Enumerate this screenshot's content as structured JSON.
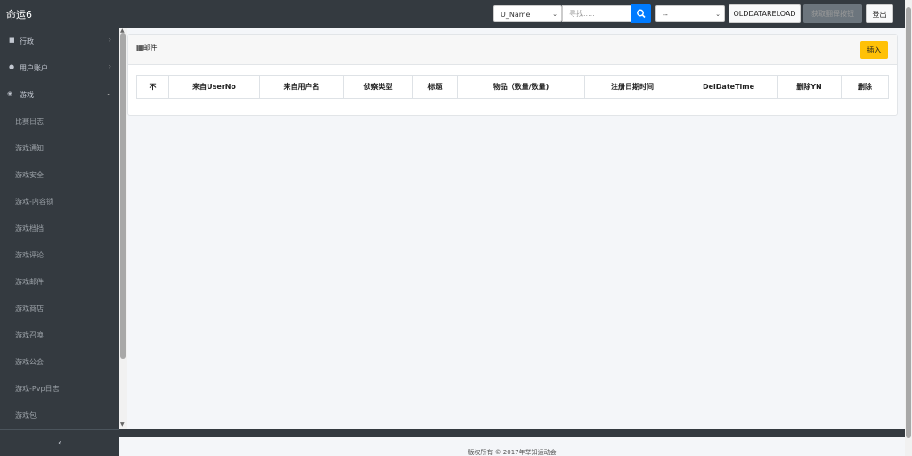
{
  "app": {
    "title": "命运6"
  },
  "header": {
    "field_select": "U_Name",
    "search_placeholder": "寻找.....",
    "second_select": "--",
    "reload_button": "OLDDATARELOAD",
    "disabled_button": "获取翻译按钮",
    "logout_button": "登出"
  },
  "sidebar": {
    "sections": [
      {
        "label": "行政",
        "icon": "bookmark-icon"
      },
      {
        "label": "用户账户",
        "icon": "user-icon"
      },
      {
        "label": "游戏",
        "icon": "gamepad-icon"
      }
    ],
    "subitems": [
      "比赛日志",
      "游戏通知",
      "游戏安全",
      "游戏-内容锁",
      "游戏档挡",
      "游戏评论",
      "游戏邮件",
      "游戏商店",
      "游戏召唤",
      "游戏公会",
      "游戏-Pvp日志",
      "游戏包"
    ],
    "collapse_label": "‹"
  },
  "card": {
    "title": "邮件",
    "insert_button": "插入",
    "columns": [
      "不",
      "来自UserNo",
      "来自用户名",
      "侦察类型",
      "标题",
      "物品（数量/数量)",
      "注册日期时间",
      "DelDateTime",
      "删除YN",
      "删除"
    ]
  },
  "footer": {
    "text": "版权所有 © 2017年举知运动会"
  }
}
